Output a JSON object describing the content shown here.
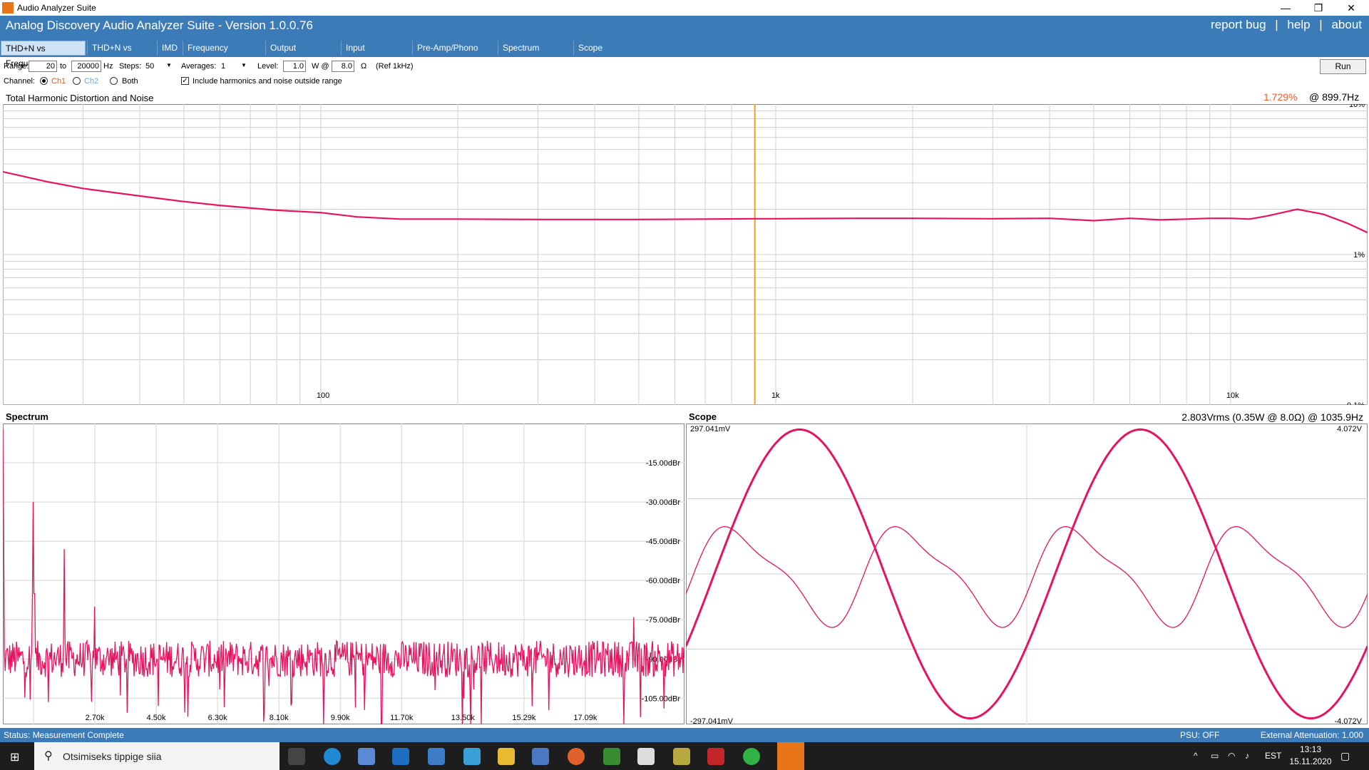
{
  "window": {
    "title": "Audio Analyzer Suite",
    "minimize": "—",
    "restore": "❐",
    "close": "✕"
  },
  "header": {
    "app_title": "Analog Discovery Audio Analyzer Suite - Version   1.0.0.76",
    "links": [
      "report bug",
      "help",
      "about"
    ],
    "separator": "|"
  },
  "tabs": [
    "THD+N vs Frequency",
    "THD+N vs Power",
    "IMD",
    "Frequency Response",
    "Output Impedance",
    "Input Impedance",
    "Pre-Amp/Phono Stage",
    "Spectrum Analyzer",
    "Scope"
  ],
  "controls": {
    "range_label": "Range:",
    "range_from": "20",
    "to_label": "to",
    "range_to": "20000",
    "hz_label": "Hz",
    "steps_label": "Steps:",
    "steps_value": "50",
    "averages_label": "Averages:",
    "averages_value": "1",
    "level_label": "Level:",
    "level_value": "1.0",
    "w_label": "W @",
    "ohm_value": "8.0",
    "ohm_label": "Ω",
    "ref_label": "(Ref 1kHz)",
    "channel_label": "Channel:",
    "ch1": "Ch1",
    "ch2": "Ch2",
    "both": "Both",
    "include_label": "Include harmonics and noise outside range",
    "run_label": "Run"
  },
  "thd_panel": {
    "title": "Total Harmonic Distortion and Noise",
    "readout_value": "1.729%",
    "readout_freq": "@ 899.7Hz"
  },
  "spectrum_panel": {
    "title": "Spectrum"
  },
  "scope_panel": {
    "title": "Scope",
    "readout": "2.803Vrms (0.35W @ 8.0Ω) @ 1035.9Hz",
    "left_top": "297.041mV",
    "left_bottom": "-297.041mV",
    "right_top": "4.072V",
    "right_bottom": "-4.072V"
  },
  "status": {
    "text": "Status: Measurement Complete",
    "psu": "PSU: OFF",
    "attenuation": "External Attenuation: 1.000"
  },
  "taskbar": {
    "search_placeholder": "Otsimiseks tippige siia",
    "lang": "EST",
    "time": "13:13",
    "date": "15.11.2020"
  },
  "colors": {
    "accent": "#3a7bb8",
    "trace": "#e8135f",
    "cursor": "#f0a020",
    "readout": "#f05a28"
  },
  "chart_data": [
    {
      "type": "line",
      "title": "Total Harmonic Distortion and Noise",
      "x_scale": "log",
      "xlim": [
        20,
        20000
      ],
      "y_scale": "log",
      "ylim": [
        0.1,
        10
      ],
      "x_tick_labels": [
        "100",
        "1k",
        "10k"
      ],
      "y_tick_labels": [
        "10%",
        "1%",
        "0.1%"
      ],
      "cursor_x": 899.7,
      "series": [
        {
          "x": [
            20,
            25,
            30,
            40,
            50,
            60,
            80,
            100,
            120,
            150,
            200,
            300,
            400,
            500,
            700,
            900,
            1000,
            1500,
            2000,
            3000,
            4000,
            5000,
            6000,
            7000,
            8000,
            9000,
            10000,
            11000,
            12000,
            14000,
            16000,
            18000,
            20000
          ],
          "y": [
            3.55,
            3.05,
            2.75,
            2.45,
            2.25,
            2.12,
            1.97,
            1.9,
            1.78,
            1.72,
            1.72,
            1.71,
            1.71,
            1.71,
            1.72,
            1.729,
            1.73,
            1.74,
            1.74,
            1.73,
            1.74,
            1.68,
            1.74,
            1.7,
            1.72,
            1.74,
            1.74,
            1.72,
            1.8,
            2.0,
            1.85,
            1.62,
            1.4
          ]
        }
      ]
    },
    {
      "type": "line",
      "title": "Spectrum",
      "xlim": [
        0,
        20000
      ],
      "ylim": [
        -115,
        0
      ],
      "x_tick_labels": [
        "2.70k",
        "4.50k",
        "6.30k",
        "8.10k",
        "9.90k",
        "11.70k",
        "13.50k",
        "15.29k",
        "17.09k"
      ],
      "y_tick_labels": [
        "-15.00dBr",
        "-30.00dBr",
        "-45.00dBr",
        "-60.00dBr",
        "-75.00dBr",
        "-90.00dBr",
        "-105.00dBr"
      ],
      "peaks": [
        {
          "x": 0,
          "y": -2
        },
        {
          "x": 900,
          "y": -30
        },
        {
          "x": 1800,
          "y": -48
        },
        {
          "x": 2700,
          "y": -70
        },
        {
          "x": 18500,
          "y": -74
        }
      ],
      "noise_floor_db": -90
    },
    {
      "type": "line",
      "title": "Scope",
      "ylim_left_mV": [
        -297.041,
        297.041
      ],
      "ylim_right_V": [
        -4.072,
        4.072
      ],
      "series": [
        {
          "kind": "fundamental",
          "amplitude_fraction": 0.96,
          "cycles": 2,
          "phase_deg": -30
        },
        {
          "kind": "residual",
          "amplitude_fraction": 0.35,
          "cycles": 4,
          "phase_deg": -20
        }
      ]
    }
  ]
}
